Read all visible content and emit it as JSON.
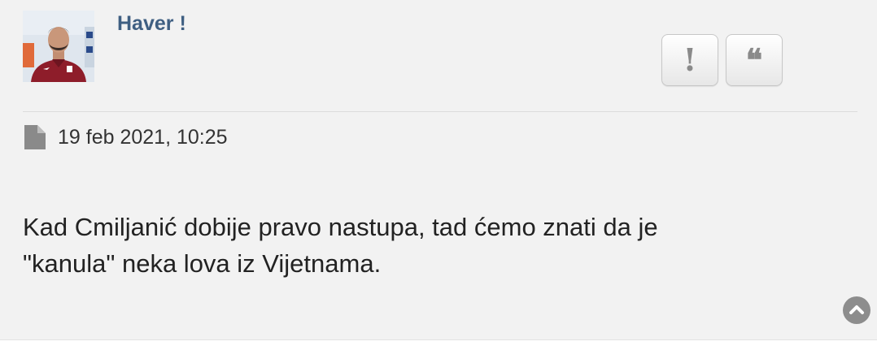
{
  "post": {
    "author": "Haver !",
    "date": "19 feb 2021, 10:25",
    "content_lines": [
      "Kad Cmiljanić dobije pravo nastupa, tad ćemo znati da je",
      "\"kanula\" neka lova iz Vijetnama."
    ]
  },
  "actions": {
    "report_icon": "exclamation-icon",
    "report_glyph": "!",
    "quote_icon": "quote-icon",
    "quote_glyph": "❝"
  },
  "icons": {
    "post_file": "file-icon",
    "back_to_top": "chevron-up-circle-icon"
  },
  "colors": {
    "background": "#f2f2f2",
    "username": "#3f5f82",
    "text": "#222222",
    "button_icon": "#8a8a8a"
  }
}
